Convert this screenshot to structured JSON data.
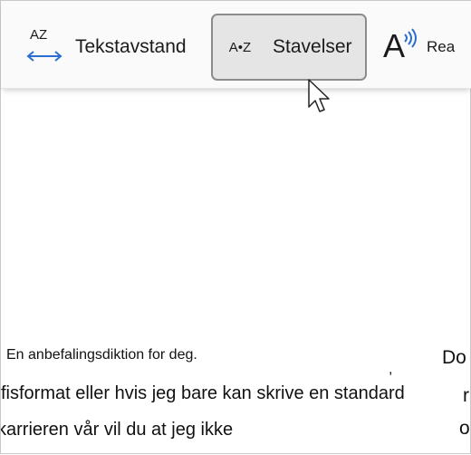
{
  "toolbar": {
    "spacing": {
      "icon": "AZ",
      "icon_name": "letter-spacing-icon",
      "label": "Tekstavstand"
    },
    "syllables": {
      "icon": "A•Z",
      "label": "Stavelser"
    },
    "read_aloud": {
      "icon": "A",
      "icon_name": "read-aloud-icon",
      "label": "Rea"
    }
  },
  "passage": {
    "line1": "En anbefalingsdiktion for deg.",
    "line2": "fisformat eller hvis jeg bare kan skrive en standard",
    "line3": "karrieren vår vil du at jeg ikke",
    "side1": "Do",
    "side2": "r",
    "side3": "o",
    "mark": ","
  },
  "colors": {
    "accent": "#2a6fd0",
    "toolbar_bg": "#fafafa",
    "selected_bg": "#e5e5e5"
  }
}
